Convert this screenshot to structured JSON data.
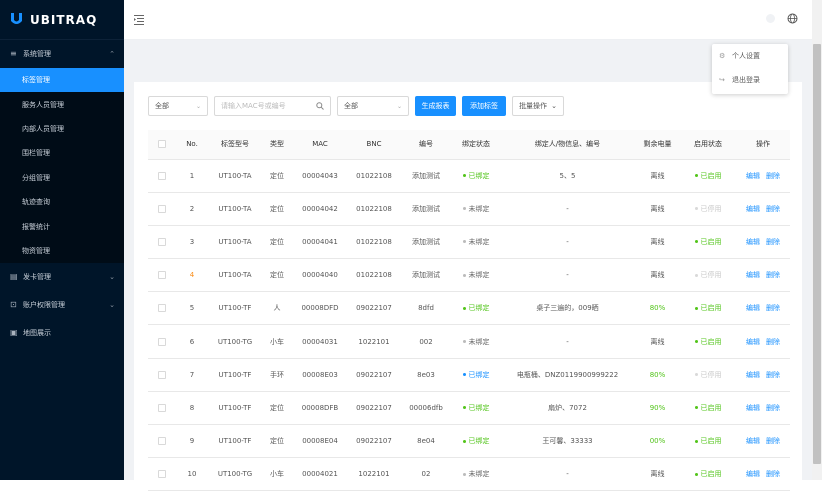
{
  "brand": {
    "name": "UBITRAQ",
    "color": "#1890ff"
  },
  "sidebar": {
    "groups": [
      {
        "label": "系统管理",
        "icon": "menu-icon",
        "arrow": "⌃",
        "items": [
          {
            "label": "标签管理",
            "active": true
          },
          {
            "label": "服务人员管理"
          },
          {
            "label": "内部人员管理"
          },
          {
            "label": "围栏管理"
          },
          {
            "label": "分组管理"
          },
          {
            "label": "轨迹查询"
          },
          {
            "label": "报警统计"
          },
          {
            "label": "物资管理"
          }
        ]
      },
      {
        "label": "发卡管理",
        "icon": "card-icon",
        "arrow": "⌄"
      },
      {
        "label": "账户权限管理",
        "icon": "user-lock-icon",
        "arrow": "⌄"
      },
      {
        "label": "地图展示",
        "icon": "map-icon"
      }
    ]
  },
  "header": {
    "user_menu": [
      {
        "label": "个人设置",
        "icon": "gear-icon"
      },
      {
        "label": "退出登录",
        "icon": "logout-icon"
      }
    ]
  },
  "toolbar": {
    "filter1": "全部",
    "search_placeholder": "请输入MAC号或编号",
    "filter2": "全部",
    "generate_label": "生成报表",
    "add_label": "添加标签",
    "batch_label": "批量操作"
  },
  "table": {
    "columns": [
      "No.",
      "标签型号",
      "类型",
      "MAC",
      "BNC",
      "编号",
      "绑定状态",
      "绑定人/物信息、编号",
      "剩余电量",
      "启用状态",
      "操作"
    ],
    "actions": {
      "edit": "编辑",
      "delete": "删除"
    },
    "rows": [
      {
        "no": "1",
        "model": "UT100-TA",
        "type": "定位",
        "mac": "00004043",
        "bnc": "01022108",
        "code": "添加测试",
        "bind": "已绑定",
        "bind_state": "on",
        "info": "5、5",
        "battery": "离线",
        "enabled": "已启用",
        "en_state": "on"
      },
      {
        "no": "2",
        "model": "UT100-TA",
        "type": "定位",
        "mac": "00004042",
        "bnc": "01022108",
        "code": "添加测试",
        "bind": "未绑定",
        "bind_state": "off",
        "info": "-",
        "battery": "离线",
        "enabled": "已停用",
        "en_state": "dis"
      },
      {
        "no": "3",
        "model": "UT100-TA",
        "type": "定位",
        "mac": "00004041",
        "bnc": "01022108",
        "code": "添加测试",
        "bind": "未绑定",
        "bind_state": "off",
        "info": "-",
        "battery": "离线",
        "enabled": "已启用",
        "en_state": "on"
      },
      {
        "no": "4",
        "model": "UT100-TA",
        "type": "定位",
        "mac": "00004040",
        "bnc": "01022108",
        "code": "添加测试",
        "bind": "未绑定",
        "bind_state": "off",
        "info": "-",
        "battery": "离线",
        "enabled": "已停用",
        "en_state": "dis"
      },
      {
        "no": "5",
        "model": "UT100-TF",
        "type": "人",
        "mac": "00008DFD",
        "bnc": "09022107",
        "code": "8dfd",
        "bind": "已绑定",
        "bind_state": "on",
        "info": "桌子三遍的，009晒",
        "battery": "80%",
        "battery_green": true,
        "enabled": "已启用",
        "en_state": "on"
      },
      {
        "no": "6",
        "model": "UT100-TG",
        "type": "小车",
        "mac": "00004031",
        "bnc": "1022101",
        "code": "002",
        "bind": "未绑定",
        "bind_state": "off",
        "info": "-",
        "battery": "离线",
        "enabled": "已启用",
        "en_state": "on"
      },
      {
        "no": "7",
        "model": "UT100-TF",
        "type": "手环",
        "mac": "00008E03",
        "bnc": "09022107",
        "code": "8e03",
        "bind": "已绑定",
        "bind_state": "blue",
        "info": "电瓶桶、DNZ0119900999222",
        "battery": "80%",
        "battery_green": true,
        "enabled": "已停用",
        "en_state": "dis"
      },
      {
        "no": "8",
        "model": "UT100-TF",
        "type": "定位",
        "mac": "00008DFB",
        "bnc": "09022107",
        "code": "00006dfb",
        "bind": "已绑定",
        "bind_state": "on",
        "info": "扇炉、7072",
        "battery": "90%",
        "battery_green": true,
        "enabled": "已启用",
        "en_state": "on"
      },
      {
        "no": "9",
        "model": "UT100-TF",
        "type": "定位",
        "mac": "00008E04",
        "bnc": "09022107",
        "code": "8e04",
        "bind": "已绑定",
        "bind_state": "on",
        "info": "王可馨、33333",
        "battery": "00%",
        "battery_green": true,
        "enabled": "已启用",
        "en_state": "on"
      },
      {
        "no": "10",
        "model": "UT100-TG",
        "type": "小车",
        "mac": "00004021",
        "bnc": "1022101",
        "code": "02",
        "bind": "未绑定",
        "bind_state": "off",
        "info": "-",
        "battery": "离线",
        "enabled": "已启用",
        "en_state": "on"
      }
    ]
  }
}
